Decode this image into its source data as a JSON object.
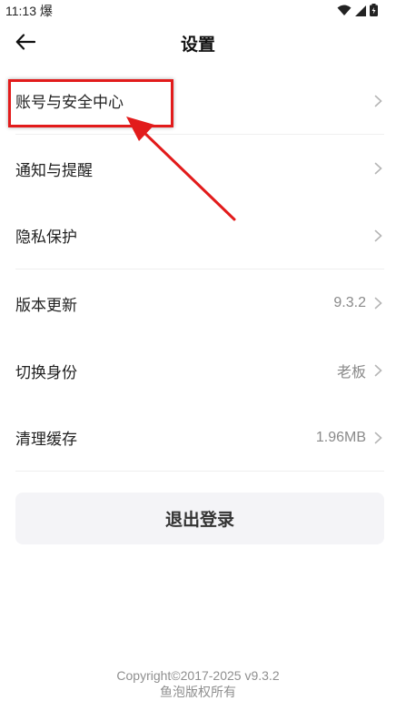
{
  "status_bar": {
    "time": "11:13",
    "app_glyph": "爆",
    "icons": [
      "wifi-icon",
      "signal-icon",
      "battery-icon"
    ]
  },
  "header": {
    "title": "设置",
    "back_icon": "arrow-left-icon"
  },
  "settings": {
    "items": [
      {
        "label": "账号与安全中心",
        "value": ""
      },
      {
        "label": "通知与提醒",
        "value": ""
      },
      {
        "label": "隐私保护",
        "value": ""
      },
      {
        "label": "版本更新",
        "value": "9.3.2"
      },
      {
        "label": "切换身份",
        "value": "老板"
      },
      {
        "label": "清理缓存",
        "value": "1.96MB"
      }
    ]
  },
  "logout": {
    "label": "退出登录"
  },
  "footer": {
    "copyright": "Copyright©2017-2025 v9.3.2",
    "owner": "鱼泡版权所有"
  },
  "colors": {
    "annotation": "#e21b1b",
    "button_bg": "#f4f4f7",
    "value_text": "#8a8a8a"
  }
}
